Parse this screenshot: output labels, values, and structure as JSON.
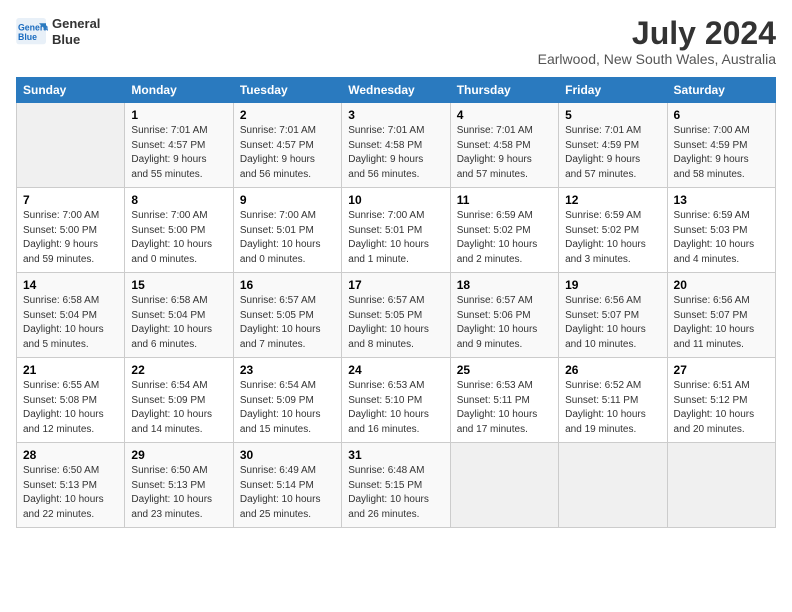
{
  "logo": {
    "line1": "General",
    "line2": "Blue"
  },
  "title": "July 2024",
  "location": "Earlwood, New South Wales, Australia",
  "days_header": [
    "Sunday",
    "Monday",
    "Tuesday",
    "Wednesday",
    "Thursday",
    "Friday",
    "Saturday"
  ],
  "weeks": [
    [
      {
        "day": "",
        "info": ""
      },
      {
        "day": "1",
        "info": "Sunrise: 7:01 AM\nSunset: 4:57 PM\nDaylight: 9 hours\nand 55 minutes."
      },
      {
        "day": "2",
        "info": "Sunrise: 7:01 AM\nSunset: 4:57 PM\nDaylight: 9 hours\nand 56 minutes."
      },
      {
        "day": "3",
        "info": "Sunrise: 7:01 AM\nSunset: 4:58 PM\nDaylight: 9 hours\nand 56 minutes."
      },
      {
        "day": "4",
        "info": "Sunrise: 7:01 AM\nSunset: 4:58 PM\nDaylight: 9 hours\nand 57 minutes."
      },
      {
        "day": "5",
        "info": "Sunrise: 7:01 AM\nSunset: 4:59 PM\nDaylight: 9 hours\nand 57 minutes."
      },
      {
        "day": "6",
        "info": "Sunrise: 7:00 AM\nSunset: 4:59 PM\nDaylight: 9 hours\nand 58 minutes."
      }
    ],
    [
      {
        "day": "7",
        "info": "Sunrise: 7:00 AM\nSunset: 5:00 PM\nDaylight: 9 hours\nand 59 minutes."
      },
      {
        "day": "8",
        "info": "Sunrise: 7:00 AM\nSunset: 5:00 PM\nDaylight: 10 hours\nand 0 minutes."
      },
      {
        "day": "9",
        "info": "Sunrise: 7:00 AM\nSunset: 5:01 PM\nDaylight: 10 hours\nand 0 minutes."
      },
      {
        "day": "10",
        "info": "Sunrise: 7:00 AM\nSunset: 5:01 PM\nDaylight: 10 hours\nand 1 minute."
      },
      {
        "day": "11",
        "info": "Sunrise: 6:59 AM\nSunset: 5:02 PM\nDaylight: 10 hours\nand 2 minutes."
      },
      {
        "day": "12",
        "info": "Sunrise: 6:59 AM\nSunset: 5:02 PM\nDaylight: 10 hours\nand 3 minutes."
      },
      {
        "day": "13",
        "info": "Sunrise: 6:59 AM\nSunset: 5:03 PM\nDaylight: 10 hours\nand 4 minutes."
      }
    ],
    [
      {
        "day": "14",
        "info": "Sunrise: 6:58 AM\nSunset: 5:04 PM\nDaylight: 10 hours\nand 5 minutes."
      },
      {
        "day": "15",
        "info": "Sunrise: 6:58 AM\nSunset: 5:04 PM\nDaylight: 10 hours\nand 6 minutes."
      },
      {
        "day": "16",
        "info": "Sunrise: 6:57 AM\nSunset: 5:05 PM\nDaylight: 10 hours\nand 7 minutes."
      },
      {
        "day": "17",
        "info": "Sunrise: 6:57 AM\nSunset: 5:05 PM\nDaylight: 10 hours\nand 8 minutes."
      },
      {
        "day": "18",
        "info": "Sunrise: 6:57 AM\nSunset: 5:06 PM\nDaylight: 10 hours\nand 9 minutes."
      },
      {
        "day": "19",
        "info": "Sunrise: 6:56 AM\nSunset: 5:07 PM\nDaylight: 10 hours\nand 10 minutes."
      },
      {
        "day": "20",
        "info": "Sunrise: 6:56 AM\nSunset: 5:07 PM\nDaylight: 10 hours\nand 11 minutes."
      }
    ],
    [
      {
        "day": "21",
        "info": "Sunrise: 6:55 AM\nSunset: 5:08 PM\nDaylight: 10 hours\nand 12 minutes."
      },
      {
        "day": "22",
        "info": "Sunrise: 6:54 AM\nSunset: 5:09 PM\nDaylight: 10 hours\nand 14 minutes."
      },
      {
        "day": "23",
        "info": "Sunrise: 6:54 AM\nSunset: 5:09 PM\nDaylight: 10 hours\nand 15 minutes."
      },
      {
        "day": "24",
        "info": "Sunrise: 6:53 AM\nSunset: 5:10 PM\nDaylight: 10 hours\nand 16 minutes."
      },
      {
        "day": "25",
        "info": "Sunrise: 6:53 AM\nSunset: 5:11 PM\nDaylight: 10 hours\nand 17 minutes."
      },
      {
        "day": "26",
        "info": "Sunrise: 6:52 AM\nSunset: 5:11 PM\nDaylight: 10 hours\nand 19 minutes."
      },
      {
        "day": "27",
        "info": "Sunrise: 6:51 AM\nSunset: 5:12 PM\nDaylight: 10 hours\nand 20 minutes."
      }
    ],
    [
      {
        "day": "28",
        "info": "Sunrise: 6:50 AM\nSunset: 5:13 PM\nDaylight: 10 hours\nand 22 minutes."
      },
      {
        "day": "29",
        "info": "Sunrise: 6:50 AM\nSunset: 5:13 PM\nDaylight: 10 hours\nand 23 minutes."
      },
      {
        "day": "30",
        "info": "Sunrise: 6:49 AM\nSunset: 5:14 PM\nDaylight: 10 hours\nand 25 minutes."
      },
      {
        "day": "31",
        "info": "Sunrise: 6:48 AM\nSunset: 5:15 PM\nDaylight: 10 hours\nand 26 minutes."
      },
      {
        "day": "",
        "info": ""
      },
      {
        "day": "",
        "info": ""
      },
      {
        "day": "",
        "info": ""
      }
    ]
  ]
}
